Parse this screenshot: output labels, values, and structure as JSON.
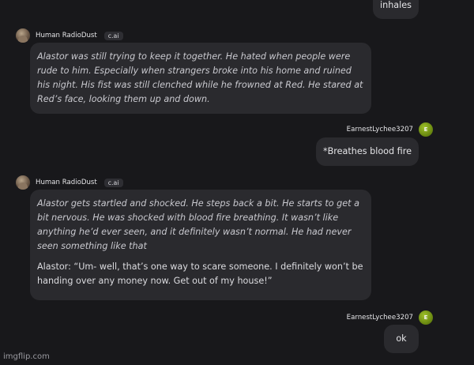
{
  "messages": [
    {
      "role": "user",
      "text": "inhales"
    },
    {
      "role": "bot",
      "name": "Human RadioDust",
      "tag": "c.ai",
      "text": "Alastor was still trying to keep it together. He hated when people were rude to him. Especially when strangers broke into his home and ruined his night. His fist was still clenched while he frowned at Red. He stared at Red’s face, looking them up and down."
    },
    {
      "role": "user",
      "name": "EarnestLychee3207",
      "avatar_letter": "E",
      "text": "*Breathes blood fire"
    },
    {
      "role": "bot",
      "name": "Human RadioDust",
      "tag": "c.ai",
      "text": "Alastor gets startled and shocked. He steps back a bit. He starts to get a bit nervous. He was shocked with blood fire breathing. It wasn’t like anything he’d ever seen, and it definitely wasn’t normal. He had never seen something like that",
      "text2": "Alastor: “Um- well, that’s one way to scare someone. I definitely won’t be handing over any money now. Get out of my house!”"
    },
    {
      "role": "user",
      "name": "EarnestLychee3207",
      "avatar_letter": "E",
      "text": "ok"
    }
  ],
  "watermark": "imgflip.com",
  "partial_next": "Human RadioDust"
}
